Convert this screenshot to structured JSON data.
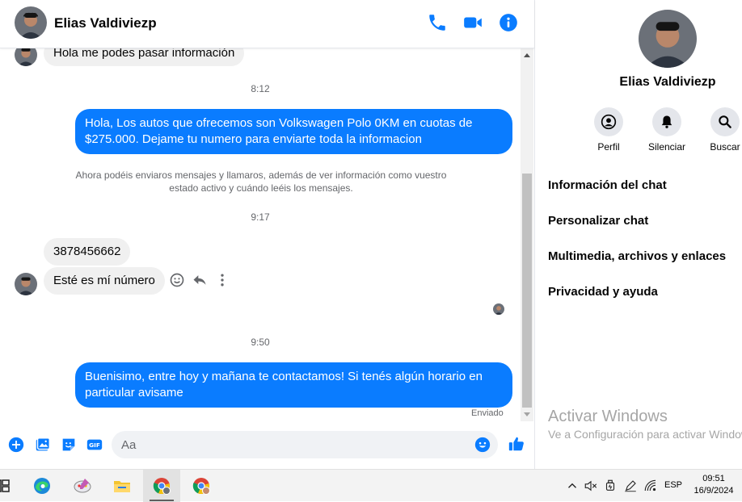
{
  "header": {
    "contact_name": "Elias Valdiviezp",
    "call_icon": "phone-icon",
    "video_icon": "video-camera-icon",
    "info_icon": "info-icon"
  },
  "messages": {
    "m1_text": "Hola me podes pasar información",
    "t1": "8:12",
    "m2_text": "Hola, Los autos que ofrecemos son Volkswagen Polo 0KM en cuotas de $275.000. Dejame tu numero para enviarte toda la informacion",
    "notice_text": "Ahora podéis enviaros mensajes y llamaros, además de ver información como vuestro estado activo y cuándo leéis los mensajes.",
    "t2": "9:17",
    "m3_text": "3878456662",
    "m4_text": "Esté es mí número",
    "t3": "9:50",
    "m5_text": "Buenisimo, entre hoy y mañana te contactamos! Si tenés algún horario en particular avisame",
    "status": "Enviado"
  },
  "composer": {
    "placeholder": "Aa"
  },
  "info_panel": {
    "name": "Elias Valdiviezp",
    "actions": [
      "Perfil",
      "Silenciar",
      "Buscar"
    ],
    "items": [
      "Información del chat",
      "Personalizar chat",
      "Multimedia, archivos y enlaces",
      "Privacidad y ayuda"
    ]
  },
  "watermark": {
    "title": "Activar Windows",
    "subtitle": "Ve a Configuración para activar Windows."
  },
  "taskbar": {
    "language": "ESP",
    "time": "09:51",
    "date": "16/9/2024"
  },
  "colors": {
    "accent": "#0a7cff",
    "incoming_bubble": "#f0f0f0",
    "secondary_text": "#65676b"
  }
}
